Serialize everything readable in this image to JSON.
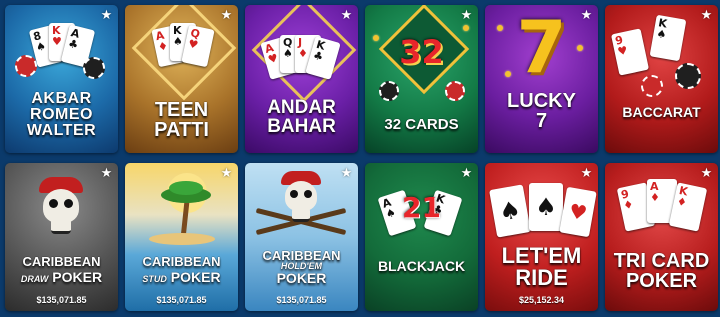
{
  "favorite_icon": "star-icon",
  "tiles": [
    {
      "id": "akbar",
      "lines": [
        "AKBAR",
        "ROMEO",
        "WALTER"
      ],
      "jackpot": null
    },
    {
      "id": "teen-patti",
      "lines": [
        "TEEN",
        "PATTI"
      ],
      "jackpot": null
    },
    {
      "id": "andar-bahar",
      "lines": [
        "ANDAR",
        "BAHAR"
      ],
      "jackpot": null
    },
    {
      "id": "32-cards",
      "art": "32",
      "lines": [
        "32 CARDS"
      ],
      "jackpot": null
    },
    {
      "id": "lucky7",
      "art": "7",
      "lines": [
        "LUCKY",
        "7"
      ],
      "jackpot": null
    },
    {
      "id": "baccarat",
      "lines": [
        "BACCARAT"
      ],
      "jackpot": null
    },
    {
      "id": "caribbean-draw",
      "lines": [
        "CARIBBEAN",
        "DRAW",
        "POKER"
      ],
      "jackpot": "$135,071.85"
    },
    {
      "id": "caribbean-stud",
      "lines": [
        "CARIBBEAN",
        "STUD",
        "POKER"
      ],
      "jackpot": "$135,071.85"
    },
    {
      "id": "caribbean-holdem",
      "lines": [
        "CARIBBEAN",
        "HOLD'EM",
        "POKER"
      ],
      "jackpot": "$135,071.85"
    },
    {
      "id": "blackjack",
      "art": "21",
      "lines": [
        "BLACKJACK"
      ],
      "jackpot": null
    },
    {
      "id": "let-em-ride",
      "lines": [
        "LET'EM",
        "RIDE"
      ],
      "jackpot": "$25,152.34"
    },
    {
      "id": "tri-card",
      "lines": [
        "TRI CARD",
        "POKER"
      ],
      "jackpot": null
    }
  ],
  "card_glyphs": {
    "spade": "♠",
    "heart": "♥",
    "club": "♣",
    "diamond": "♦",
    "star": "★"
  },
  "card_ranks": [
    "8",
    "K",
    "A",
    "9",
    "Q",
    "J"
  ]
}
